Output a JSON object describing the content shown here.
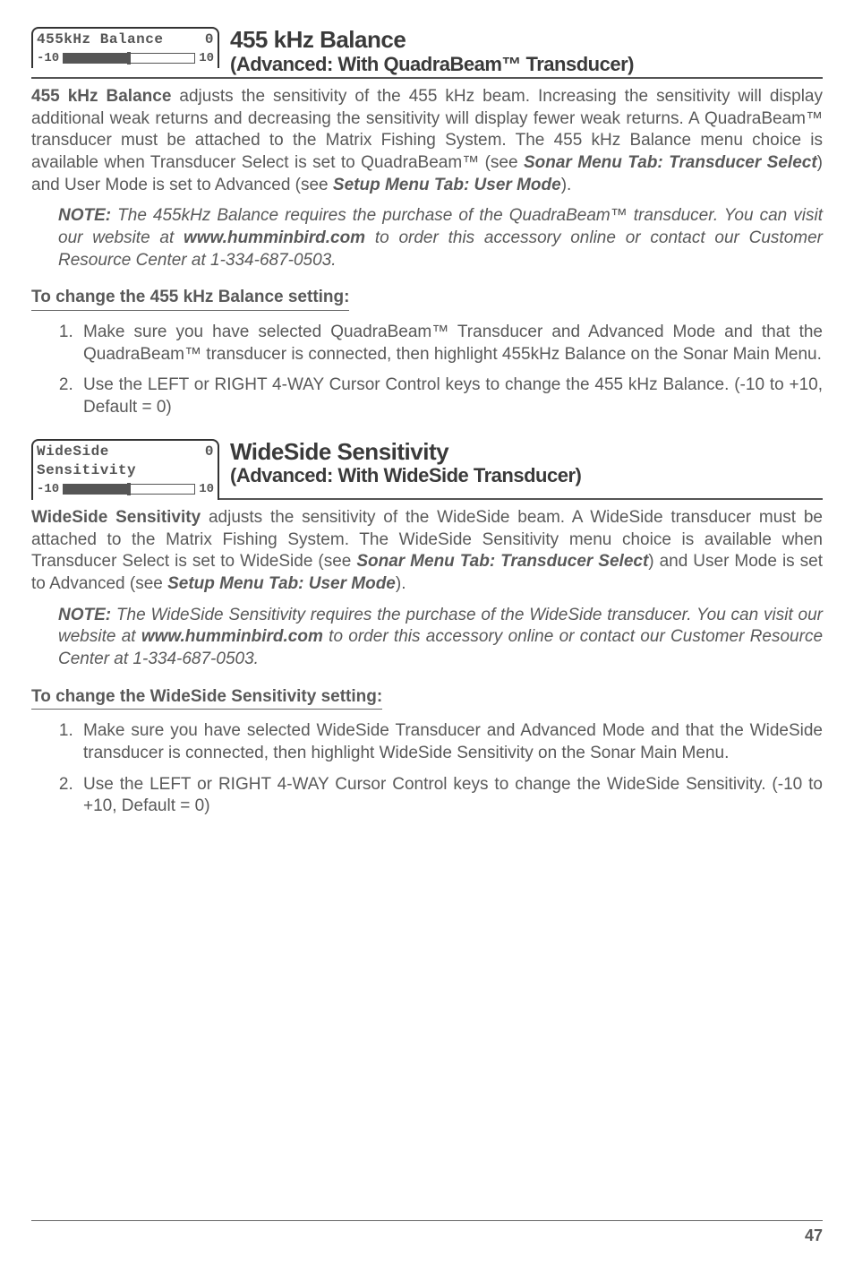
{
  "s1": {
    "widget": {
      "title": "455kHz Balance",
      "value": "0",
      "min": "-10",
      "max": "10"
    },
    "title": "455 kHz Balance",
    "subtitle": "(Advanced: With QuadraBeam™ Transducer)",
    "para1_a": "455 kHz Balance",
    "para1_b": " adjusts the sensitivity of the 455 kHz beam.  Increasing the sensitivity will display additional weak returns and decreasing the sensitivity will display fewer weak returns. A QuadraBeam™ transducer must be attached to the Matrix Fishing System. The 455 kHz Balance menu choice is available when Transducer Select is set to QuadraBeam™ (see ",
    "para1_c": "Sonar Menu Tab: Transducer Select",
    "para1_d": ") and User Mode is set to Advanced (see ",
    "para1_e": "Setup Menu Tab: User Mode",
    "para1_f": ").",
    "note_a": "NOTE:",
    "note_b": " The 455kHz Balance requires the purchase of the QuadraBeam™ transducer.  You can visit our website at ",
    "note_c": "www.humminbird.com",
    "note_d": " to order this accessory online or contact our Customer Resource Center at 1-334-687-0503.",
    "subhead": "To change the 455 kHz Balance setting:",
    "li1": "Make sure you have selected QuadraBeam™ Transducer and Advanced Mode and that the QuadraBeam™ transducer is connected, then highlight 455kHz Balance on the Sonar Main Menu.",
    "li2": "Use the LEFT or RIGHT 4-WAY Cursor Control keys to change the 455 kHz Balance. (-10 to +10, Default = 0)"
  },
  "s2": {
    "widget": {
      "title": "WideSide Sensitivity",
      "value": "0",
      "min": "-10",
      "max": "10"
    },
    "title": "WideSide Sensitivity",
    "subtitle": "(Advanced: With WideSide Transducer)",
    "para1_a": "WideSide Sensitivity",
    "para1_b": " adjusts the sensitivity of the WideSide beam. A WideSide transducer must be attached to the Matrix Fishing System.  The WideSide Sensitivity menu choice is available when Transducer Select is set to WideSide (see ",
    "para1_c": "Sonar Menu Tab: Transducer Select",
    "para1_d": ") and User Mode is set to Advanced (see ",
    "para1_e": "Setup Menu Tab: User Mode",
    "para1_f": ").",
    "note_a": "NOTE:",
    "note_b": " The WideSide Sensitivity requires the purchase of the WideSide transducer.  You can visit our website at ",
    "note_c": "www.humminbird.com",
    "note_d": " to order this accessory online or contact our Customer Resource Center at 1-334-687-0503.",
    "subhead": "To change the WideSide Sensitivity setting:",
    "li1": "Make sure you have selected WideSide Transducer and Advanced Mode and that the WideSide transducer is connected, then highlight WideSide Sensitivity on the Sonar Main Menu.",
    "li2": "Use the LEFT or RIGHT 4-WAY Cursor Control keys to change the WideSide Sensitivity. (-10 to +10, Default = 0)"
  },
  "page": "47"
}
